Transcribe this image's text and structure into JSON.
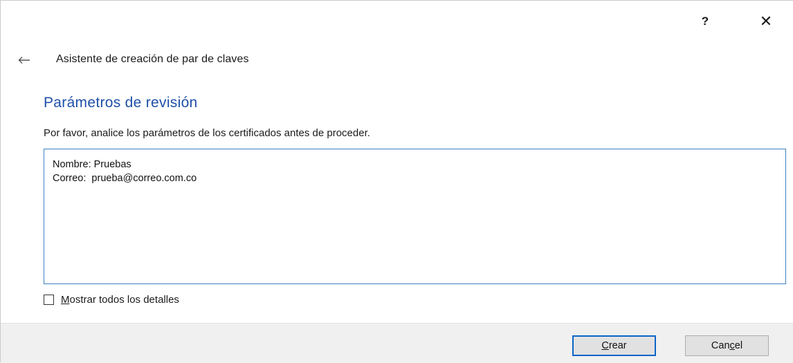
{
  "titlebar": {
    "help_label": "?",
    "close_label": "✕"
  },
  "wizard": {
    "title": "Asistente de creación de par de claves"
  },
  "section": {
    "title": "Parámetros de revisión",
    "instruction": "Por favor, analice los parámetros de los certificados antes de proceder."
  },
  "params": [
    {
      "label": "Nombre:",
      "value": "Pruebas"
    },
    {
      "label": "Correo:",
      "value": "prueba@correo.com.co"
    }
  ],
  "details_checkbox": {
    "accel": "M",
    "label_rest": "ostrar todos los detalles",
    "checked": false
  },
  "buttons": {
    "create_accel": "C",
    "create_rest": "rear",
    "cancel_pre": "Can",
    "cancel_accel": "c",
    "cancel_rest": "el"
  },
  "colors": {
    "section_title": "#1f4fa8",
    "box_border": "#3c7fc1",
    "default_button_border": "#0a64c8",
    "footer_bg": "#f0f0f0"
  }
}
